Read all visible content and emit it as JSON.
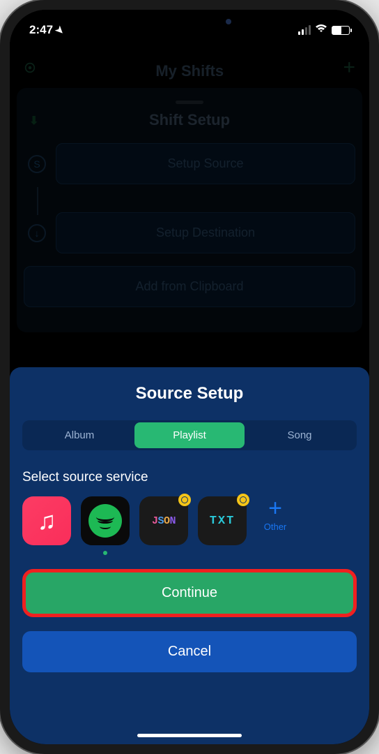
{
  "status": {
    "time": "2:47",
    "location_active": true
  },
  "background": {
    "nav_title": "My Shifts",
    "sheet_title": "Shift Setup",
    "step_source": "Setup Source",
    "step_destination": "Setup Destination",
    "clipboard": "Add from Clipboard"
  },
  "modal": {
    "title": "Source Setup",
    "segments": {
      "album": "Album",
      "playlist": "Playlist",
      "song": "Song",
      "active": "playlist"
    },
    "service_label": "Select source service",
    "services": {
      "apple_music": "Apple Music",
      "spotify": "Spotify",
      "json": "JSON",
      "txt": "TXT",
      "other_label": "Other",
      "selected": "spotify"
    },
    "continue": "Continue",
    "cancel": "Cancel"
  }
}
